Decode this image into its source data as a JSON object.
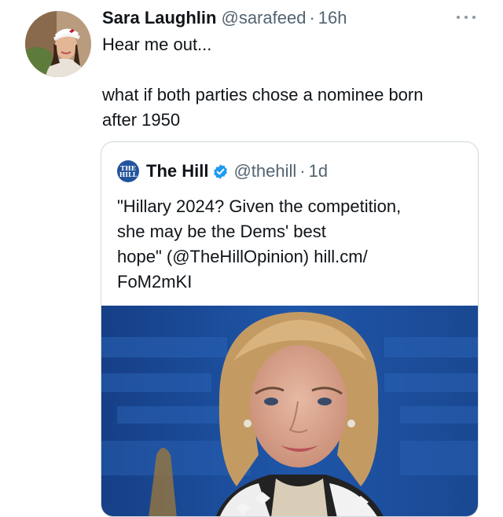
{
  "tweet": {
    "author_name": "Sara Laughlin",
    "author_handle": "@sarafeed",
    "separator": "·",
    "timestamp": "16h",
    "text_line1": "Hear me out...",
    "text_line2": "what if both parties chose a nominee born",
    "text_line3": "after 1950"
  },
  "quoted_tweet": {
    "avatar_text_line1": "THE",
    "avatar_text_line2": "HILL",
    "author_name": "The Hill",
    "author_handle": "@thehill",
    "separator": "·",
    "timestamp": "1d",
    "text_line1": "\"Hillary 2024? Given the competition,",
    "text_line2": "she may be the Dems' best",
    "text_line3": "hope\" (@TheHillOpinion) hill.cm/",
    "text_line4": "FoM2mKI"
  },
  "icons": {
    "more": "more-horizontal-icon",
    "verified": "verified-badge-icon"
  },
  "colors": {
    "text_primary": "#0f1419",
    "text_secondary": "#536471",
    "verified_blue": "#1d9bf0",
    "card_border": "#cfd9de",
    "hill_brand": "#23539c",
    "photo_background": "#1d4b96"
  }
}
